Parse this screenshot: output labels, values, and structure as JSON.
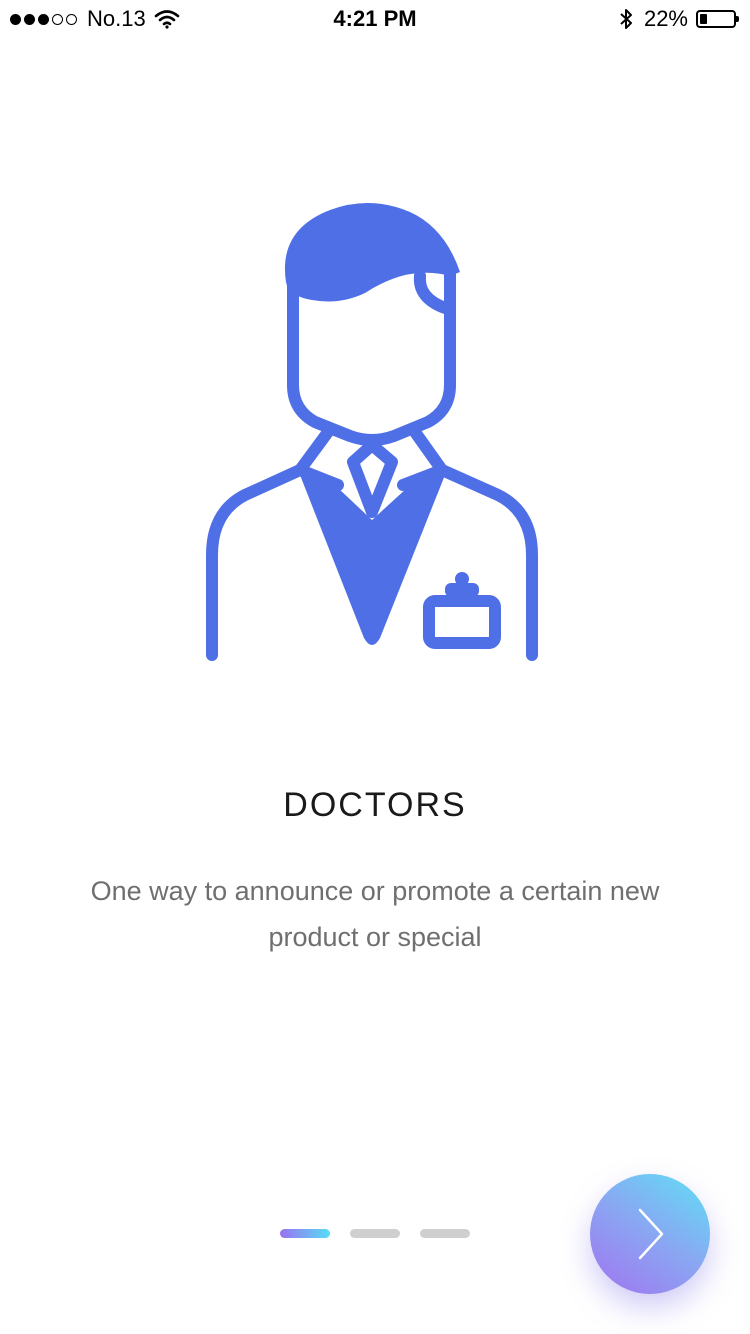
{
  "status_bar": {
    "carrier": "No.13",
    "time": "4:21 PM",
    "battery_percent": "22%",
    "battery_level": 0.22,
    "signal_icon": "signal-dots-icon",
    "wifi_icon": "wifi-icon",
    "bluetooth_icon": "bluetooth-icon"
  },
  "onboarding": {
    "illustration_icon": "doctor-icon",
    "title": "DOCTORS",
    "description": "One way to announce or promote a certain new product or special",
    "pages_total": 3,
    "current_page": 1,
    "next_icon": "chevron-right-icon"
  },
  "colors": {
    "accent": "#4f6fe6",
    "gradient_start": "#a173f0",
    "gradient_end": "#5fe0f6",
    "inactive_dot": "#cfcfcf"
  }
}
